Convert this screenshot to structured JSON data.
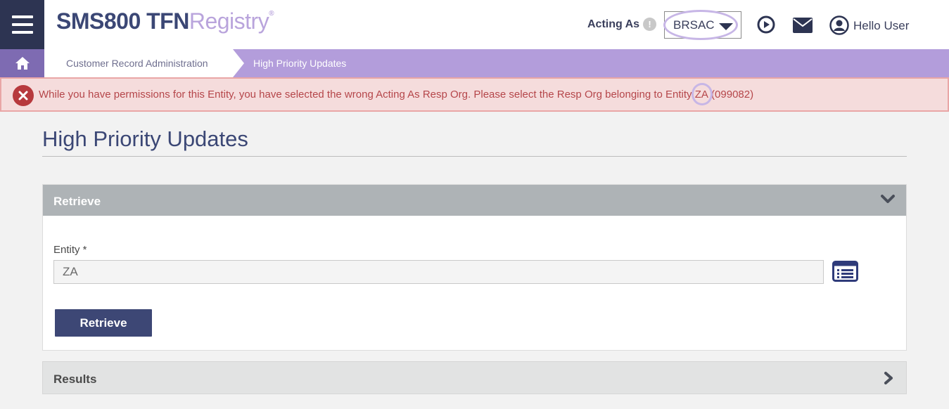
{
  "header": {
    "logo_part1": "SMS800 TFN",
    "logo_part2": "Registry",
    "logo_mark": "®",
    "acting_as_label": "Acting As",
    "info_glyph": "!",
    "acting_as_value": "BRSAC",
    "greeting": "Hello User",
    "icons": [
      "menu-icon",
      "play-circle-icon",
      "mail-icon",
      "user-circle-icon"
    ],
    "colors": {
      "navy": "#2d3452",
      "lavender": "#b39ddb",
      "brand_blue": "#3b4775"
    }
  },
  "breadcrumb": {
    "home_icon": "home-icon",
    "items": [
      "Customer Record Administration",
      "High Priority Updates"
    ]
  },
  "alert": {
    "icon": "error-x-icon",
    "message_before": "While you have permissions for this Entity, you have selected the wrong Acting As Resp Org. Please select the Resp Org belonging to Entity ",
    "entity": "ZA",
    "message_after": " (099082)",
    "colors": {
      "background": "#f5dcdc",
      "text": "#b5464a"
    }
  },
  "page": {
    "title": "High Priority Updates"
  },
  "retrieve_panel": {
    "title": "Retrieve",
    "entity_label": "Entity *",
    "entity_value": "ZA",
    "list_icon": "list-icon",
    "button_label": "Retrieve"
  },
  "results_panel": {
    "title": "Results"
  }
}
